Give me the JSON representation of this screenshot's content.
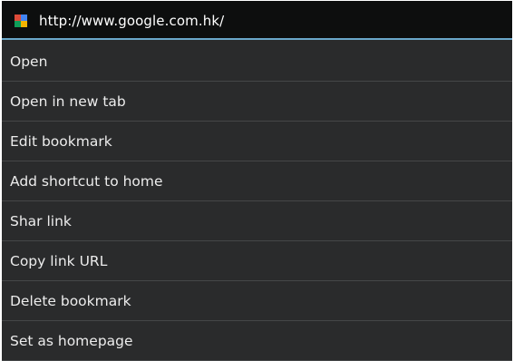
{
  "header": {
    "url": "http://www.google.com.hk/",
    "favicon": {
      "icon": "google-favicon-icon",
      "colors": [
        "#dd4b39",
        "#4285f4",
        "#0f9d58",
        "#f4b400"
      ]
    }
  },
  "menu": {
    "items": [
      {
        "label": "Open"
      },
      {
        "label": "Open in new tab"
      },
      {
        "label": "Edit bookmark"
      },
      {
        "label": "Add shortcut to home"
      },
      {
        "label": "Shar link"
      },
      {
        "label": "Copy link URL"
      },
      {
        "label": "Delete bookmark"
      },
      {
        "label": "Set as homepage"
      }
    ]
  },
  "colors": {
    "header_bg": "#0d0e0e",
    "menu_bg": "#2a2b2c",
    "divider": "#454748",
    "accent": "#6aa7c9",
    "text": "#ececec"
  }
}
